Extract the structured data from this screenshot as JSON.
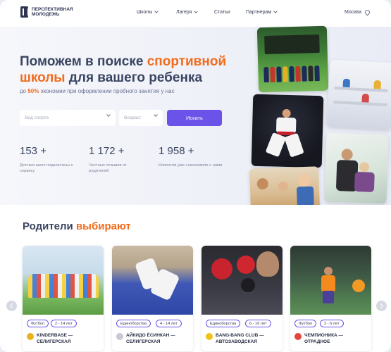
{
  "header": {
    "logo_line1": "ПЕРСПЕКТИВНАЯ",
    "logo_line2": "МОЛОДЕЖЬ",
    "nav": [
      {
        "label": "Школы",
        "dropdown": true
      },
      {
        "label": "Лагеря",
        "dropdown": true
      },
      {
        "label": "Статьи",
        "dropdown": false
      },
      {
        "label": "Партнерам",
        "dropdown": true
      }
    ],
    "city": "Москва"
  },
  "hero": {
    "title_part1": "Поможем в поиске ",
    "title_accent1": "спортивной",
    "title_accent2": "школы",
    "title_part2": " для вашего ребенка",
    "sub_prefix": "до ",
    "sub_percent": "50%",
    "sub_suffix": " экономии при оформлении пробного занятия у нас",
    "sport_placeholder": "Вид спорта",
    "age_placeholder": "Возраст",
    "search_label": "Искать",
    "stats": [
      {
        "value": "153 +",
        "label": "Детских школ подключены к сервису"
      },
      {
        "value": "1 172 +",
        "label": "Честных отзывов от родителей"
      },
      {
        "value": "1 958 +",
        "label": "Клиентов уже сэкономили с нами"
      }
    ]
  },
  "section": {
    "title_part1": "Родители ",
    "title_accent": "выбирают",
    "cards": [
      {
        "sport": "Футбол",
        "age": "2 - 14 лет",
        "title": "KINDERBASE — СЕЛИГЕРСКАЯ",
        "logo_color": "#e9b21c"
      },
      {
        "sport": "Единоборства",
        "age": "4 - 14 лет",
        "title": "АЙКИДО ЁСИНКАН — СЕЛИГЕРСКАЯ",
        "logo_color": "#c7c9d4"
      },
      {
        "sport": "Единоборства",
        "age": "6 - 16 лет",
        "title": "BANG-BANG CLUB — АВТОЗАВОДСКАЯ",
        "logo_color": "#f2c21a"
      },
      {
        "sport": "Футбол",
        "age": "3 - 6 лет",
        "title": "ЧЕМПИОНИКА — ОТРАДНОЕ",
        "logo_color": "#e3463a"
      }
    ]
  },
  "colors": {
    "accent": "#f16b1c",
    "primary": "#6b52e8",
    "heading": "#3a4561"
  }
}
